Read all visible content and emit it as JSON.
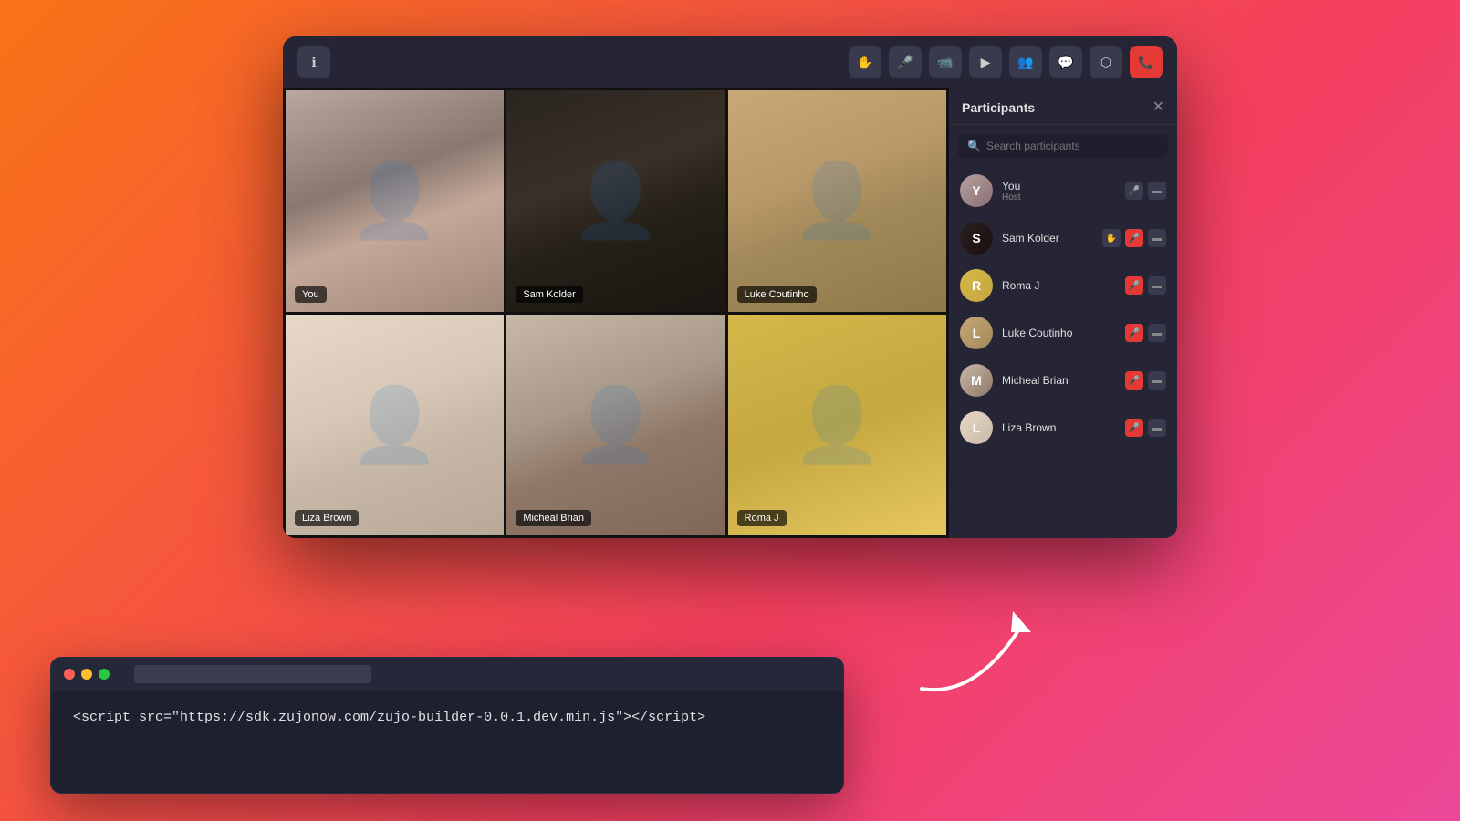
{
  "background": {
    "gradient_start": "#f97316",
    "gradient_end": "#ec4899"
  },
  "video_window": {
    "top_bar": {
      "info_icon": "ℹ",
      "hand_icon": "✋",
      "mic_icon": "🎤",
      "camera_icon": "📷",
      "screen_share_icon": "▶",
      "participants_icon": "👥",
      "chat_icon": "💬",
      "apps_icon": "⬡",
      "end_call_icon": "📞"
    },
    "participants_panel": {
      "title": "Participants",
      "close": "✕",
      "search_placeholder": "Search participants",
      "participants": [
        {
          "name": "You",
          "role": "Host",
          "avatar_class": "you-av",
          "mic": "active",
          "cam": "active"
        },
        {
          "name": "Sam Kolder",
          "role": "",
          "avatar_class": "sam-av",
          "mic": "hand",
          "cam": "muted"
        },
        {
          "name": "Roma J",
          "role": "",
          "avatar_class": "roma-av",
          "mic": "muted",
          "cam": "active"
        },
        {
          "name": "Luke Coutinho",
          "role": "",
          "avatar_class": "luke-av",
          "mic": "muted",
          "cam": "active"
        },
        {
          "name": "Micheal Brian",
          "role": "",
          "avatar_class": "micheal-av",
          "mic": "muted",
          "cam": "active"
        },
        {
          "name": "Liza Brown",
          "role": "",
          "avatar_class": "liza-av",
          "mic": "muted",
          "cam": "active"
        }
      ]
    },
    "video_tiles": [
      {
        "name": "You",
        "tile_class": "tile-you"
      },
      {
        "name": "Sam Kolder",
        "tile_class": "tile-sam"
      },
      {
        "name": "Luke Coutinho",
        "tile_class": "tile-luke"
      },
      {
        "name": "Liza Brown",
        "tile_class": "tile-liza"
      },
      {
        "name": "Micheal Brian",
        "tile_class": "tile-micheal"
      },
      {
        "name": "Roma J",
        "tile_class": "tile-roma"
      }
    ]
  },
  "terminal": {
    "code": "<script src=\"https://sdk.zujonow.com/zujo-builder-0.0.1.dev.min.js\"></script>"
  }
}
